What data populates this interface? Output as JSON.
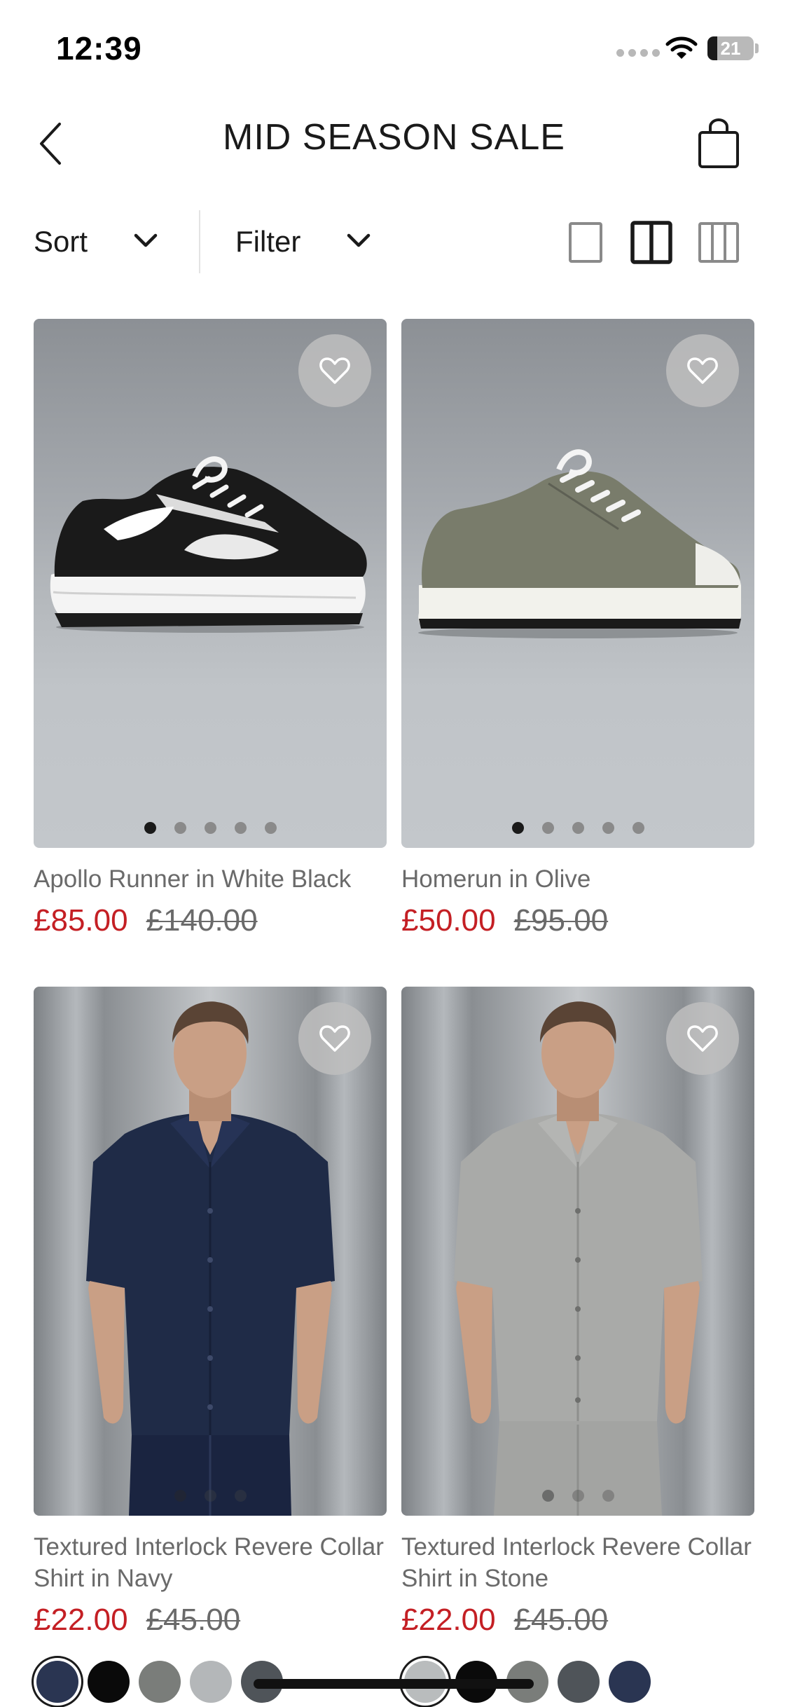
{
  "status_bar": {
    "time": "12:39",
    "battery": "21",
    "battery_percent": 21,
    "icons": [
      "signal-dots-icon",
      "wifi-icon",
      "battery-icon"
    ]
  },
  "header": {
    "title": "MID SEASON SALE",
    "back_icon": "chevron-left-icon",
    "bag_icon": "shopping-bag-icon"
  },
  "toolbar": {
    "sort_label": "Sort",
    "filter_label": "Filter",
    "view_options": [
      "single-column-view-icon",
      "two-column-view-icon",
      "three-column-view-icon"
    ],
    "active_view": "two-column"
  },
  "products": [
    {
      "name": "Apollo Runner in White Black",
      "sale_price": "£85.00",
      "original_price": "£140.00",
      "image_count": 5,
      "active_image": 1
    },
    {
      "name": "Homerun in Olive",
      "sale_price": "£50.00",
      "original_price": "£95.00",
      "image_count": 5,
      "active_image": 1
    },
    {
      "name": "Textured Interlock Revere Collar Shirt in Navy",
      "sale_price": "£22.00",
      "original_price": "£45.00",
      "image_count": 3,
      "active_image": 1,
      "swatches": [
        "#2a3552",
        "#0a0a0a",
        "#7a7d7a",
        "#b4b7b9",
        "#4f5459"
      ]
    },
    {
      "name": "Textured Interlock Revere Collar Shirt in Stone",
      "sale_price": "£22.00",
      "original_price": "£45.00",
      "image_count": 3,
      "active_image": 1,
      "swatches": [
        "#b9bcbd",
        "#0a0a0a",
        "#7a7d7a",
        "#4f5459",
        "#2a3552"
      ]
    }
  ],
  "colors": {
    "sale_red": "#c41f24",
    "text_dark": "#1a1a1a",
    "text_muted": "#6a6a6a"
  }
}
